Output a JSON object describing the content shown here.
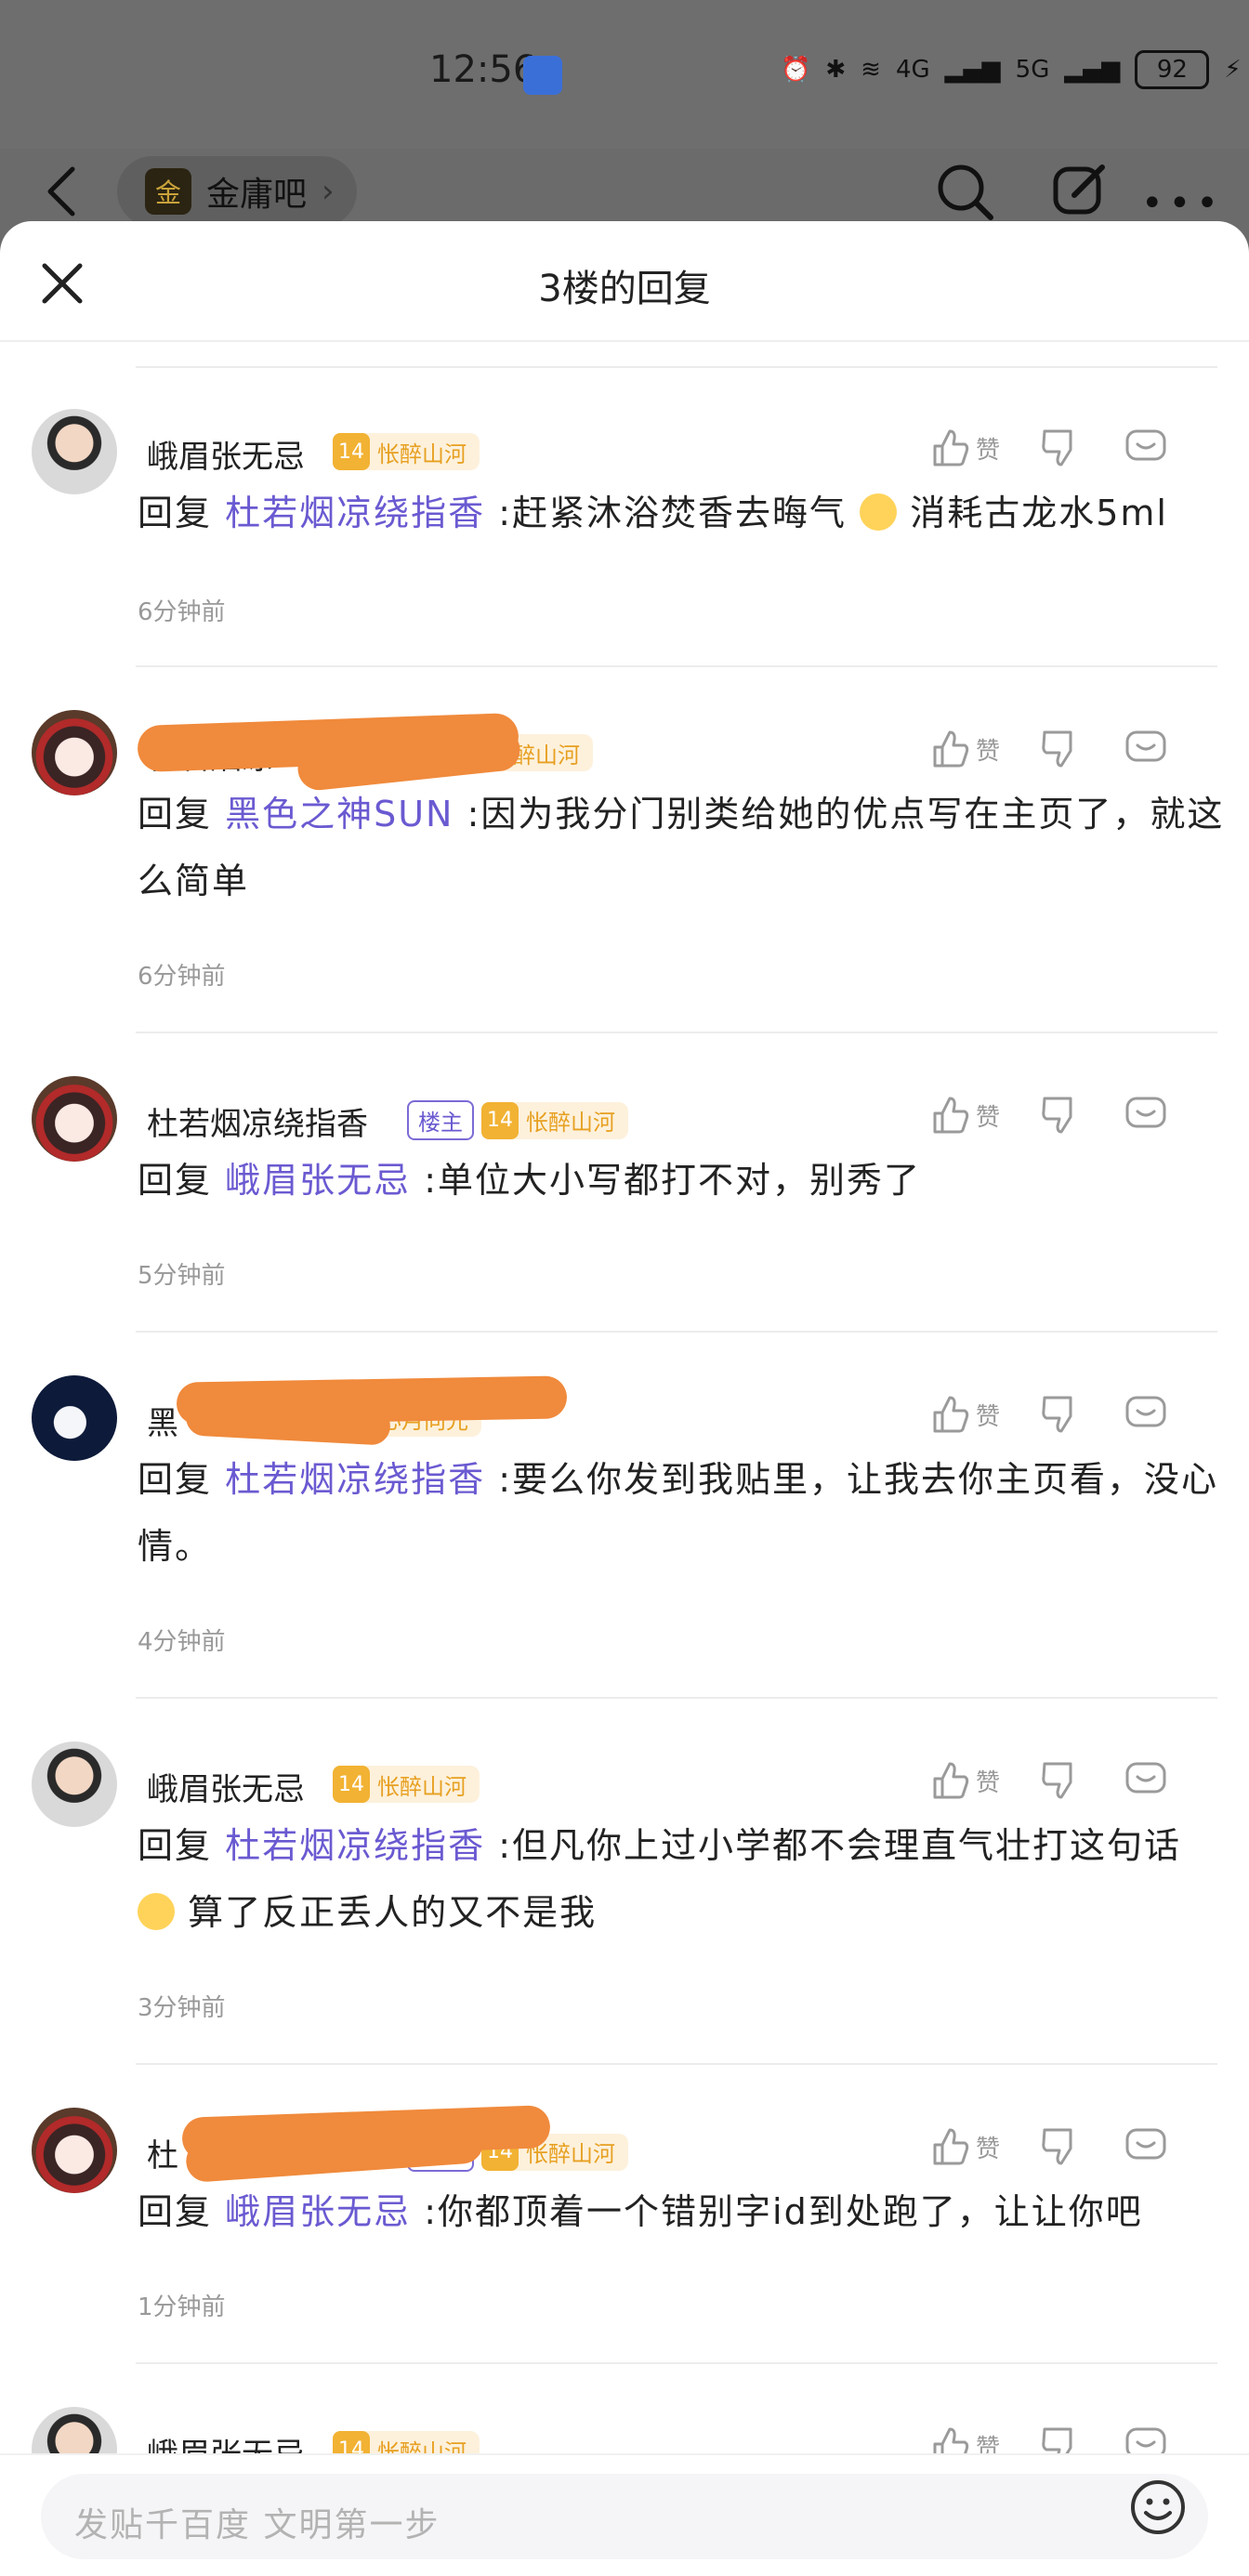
{
  "status_bar": {
    "time": "12:56",
    "network_left": "4G",
    "network_right": "5G",
    "battery": "92"
  },
  "topnav": {
    "forum_logo": "金",
    "forum_name": "金庸吧"
  },
  "sheet": {
    "title": "3楼的回复"
  },
  "replies": [
    {
      "username": "峨眉张无忌",
      "level": "14",
      "level_title": "怅醉山河",
      "is_owner": false,
      "like_label": "赞",
      "prefix": "回复",
      "target": "杜若烟凉绕指香",
      "text_before": ":赶紧沐浴焚香去晦气",
      "text_after": "消耗古龙水5ml",
      "time": "6分钟前"
    },
    {
      "username": "杜若烟凉",
      "level": "",
      "level_title": "怅醉山河",
      "is_owner": false,
      "like_label": "赞",
      "prefix": "回复",
      "target": "黑色之神SUN",
      "text": ":因为我分门别类给她的优点写在主页了，就这么简单",
      "time": "6分钟前"
    },
    {
      "username": "杜若烟凉绕指香",
      "owner_label": "楼主",
      "level": "14",
      "level_title": "怅醉山河",
      "is_owner": true,
      "like_label": "赞",
      "prefix": "回复",
      "target": "峨眉张无忌",
      "text": ":单位大小写都打不对，别秀了",
      "time": "5分钟前"
    },
    {
      "username": "黑",
      "level_title": "心月向光",
      "is_owner": false,
      "like_label": "赞",
      "prefix": "回复",
      "target": "杜若烟凉绕指香",
      "text": ":要么你发到我贴里，让我去你主页看，没心情。",
      "time": "4分钟前"
    },
    {
      "username": "峨眉张无忌",
      "level": "14",
      "level_title": "怅醉山河",
      "is_owner": false,
      "like_label": "赞",
      "prefix": "回复",
      "target": "杜若烟凉绕指香",
      "text_before": ":但凡你上过小学都不会理直气壮打这句话",
      "text_after": "算了反正丢人的又不是我",
      "time": "3分钟前"
    },
    {
      "username": "杜",
      "owner_label": "楼主",
      "level": "14",
      "level_title": "怅醉山河",
      "is_owner": true,
      "like_label": "赞",
      "prefix": "回复",
      "target": "峨眉张无忌",
      "text": ":你都顶着一个错别字id到处跑了，让让你吧",
      "time": "1分钟前"
    },
    {
      "username": "峨眉张无忌",
      "level": "14",
      "level_title": "怅醉山河",
      "like_label": "赞"
    }
  ],
  "input": {
    "placeholder": "发贴千百度 文明第一步"
  }
}
